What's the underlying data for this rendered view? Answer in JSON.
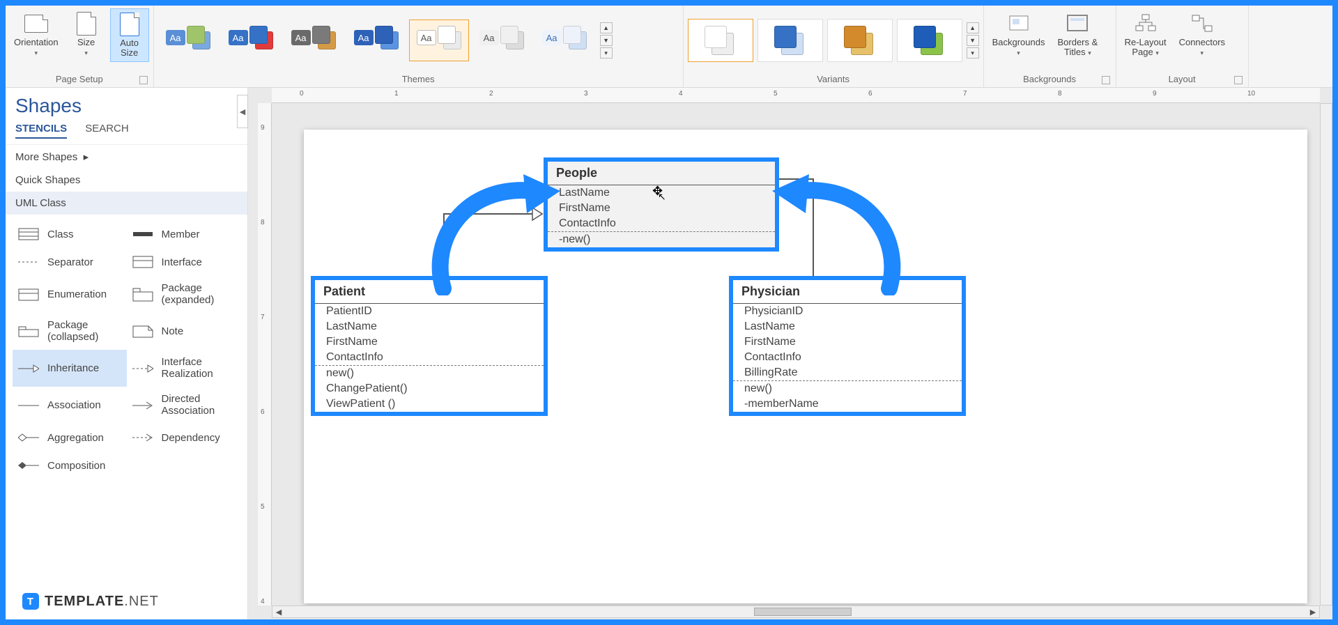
{
  "ribbon": {
    "page_setup": {
      "orientation": "Orientation",
      "size": "Size",
      "auto_size": "Auto\nSize",
      "label": "Page Setup"
    },
    "themes_label": "Themes",
    "variants_label": "Variants",
    "backgrounds": {
      "backgrounds": "Backgrounds",
      "borders": "Borders &\nTitles",
      "label": "Backgrounds"
    },
    "layout": {
      "relayout": "Re-Layout\nPage",
      "connectors": "Connectors",
      "label": "Layout"
    }
  },
  "shapes_panel": {
    "title": "Shapes",
    "tabs": {
      "stencils": "STENCILS",
      "search": "SEARCH"
    },
    "rows": {
      "more": "More Shapes",
      "quick": "Quick Shapes",
      "uml": "UML Class"
    },
    "items": {
      "class": "Class",
      "member": "Member",
      "separator": "Separator",
      "interface": "Interface",
      "enumeration": "Enumeration",
      "package_exp": "Package\n(expanded)",
      "package_col": "Package\n(collapsed)",
      "note": "Note",
      "inheritance": "Inheritance",
      "iface_real": "Interface\nRealization",
      "association": "Association",
      "dir_assoc": "Directed\nAssociation",
      "aggregation": "Aggregation",
      "dependency": "Dependency",
      "composition": "Composition"
    }
  },
  "uml": {
    "people": {
      "name": "People",
      "attrs": [
        "LastName",
        "FirstName",
        "ContactInfo"
      ],
      "ops": [
        "-new()"
      ]
    },
    "patient": {
      "name": "Patient",
      "attrs": [
        "PatientID",
        "LastName",
        "FirstName",
        "ContactInfo"
      ],
      "ops": [
        "new()",
        "ChangePatient()",
        "ViewPatient ()"
      ]
    },
    "physician": {
      "name": "Physician",
      "attrs": [
        "PhysicianID",
        "LastName",
        "FirstName",
        "ContactInfo",
        "BillingRate"
      ],
      "ops": [
        "new()",
        "-memberName"
      ]
    }
  },
  "ruler_h": [
    "0",
    "1",
    "2",
    "3",
    "4",
    "5",
    "6",
    "7",
    "8",
    "9",
    "10"
  ],
  "ruler_v": [
    "9",
    "8",
    "7",
    "6",
    "5",
    "4"
  ],
  "watermark": {
    "brand": "TEMPLATE",
    "suffix": ".NET"
  }
}
